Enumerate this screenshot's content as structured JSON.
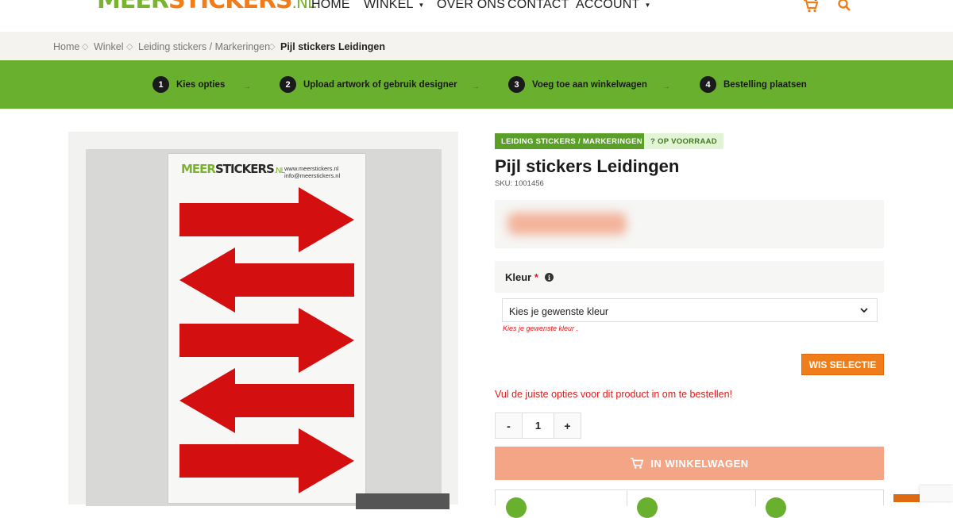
{
  "header": {
    "logo": {
      "meer": "MEER",
      "stickers": "STICKERS",
      "nl": ".NL"
    },
    "nav": [
      {
        "label": "HOME",
        "dropdown": false
      },
      {
        "label": "WINKEL",
        "dropdown": true
      },
      {
        "label": "OVER ONS",
        "dropdown": false
      },
      {
        "label": "CONTACT",
        "dropdown": false
      },
      {
        "label": "ACCOUNT",
        "dropdown": true
      }
    ],
    "cart_count": "0",
    "accent_color": "#f07d1a"
  },
  "breadcrumb": {
    "items": [
      "Home",
      "Winkel",
      "Leiding stickers / Markeringen"
    ],
    "current": "Pijl stickers Leidingen",
    "separator": "◇"
  },
  "steps": [
    {
      "num": "1",
      "label": "Kies opties"
    },
    {
      "num": "2",
      "label": "Upload artwork of gebruik designer"
    },
    {
      "num": "3",
      "label": "Voeg toe aan winkelwagen"
    },
    {
      "num": "4",
      "label": "Bestelling plaatsen"
    }
  ],
  "product_image": {
    "sheet_logo": {
      "m": "MEER",
      "s": "STICKERS",
      "n": ".NL"
    },
    "sheet_url_1": "www.meerstickers.nl",
    "sheet_url_2": "info@meerstickers.nl",
    "arrow_color": "#d40f0f",
    "arrow_directions": [
      "right",
      "left",
      "right",
      "left",
      "right"
    ]
  },
  "product": {
    "category_badge": "LEIDING STICKERS / MARKERINGEN",
    "stock_badge": "? OP VOORRAAD",
    "title": "Pijl stickers Leidingen",
    "sku": "SKU: 1001456"
  },
  "options": {
    "label": "Kleur",
    "required_mark": "*",
    "select_value": "Kies je gewenste kleur",
    "error": "Kies je gewenste kleur .",
    "clear_button": "WIS SELECTIE",
    "warning": "Vul de juiste opties voor dit product in om te bestellen!"
  },
  "quantity": {
    "minus": "-",
    "value": "1",
    "plus": "+"
  },
  "add_to_cart": "IN WINKELWAGEN",
  "colors": {
    "green": "#6ab02f",
    "orange": "#f07d1a",
    "red": "#e01b1b"
  }
}
